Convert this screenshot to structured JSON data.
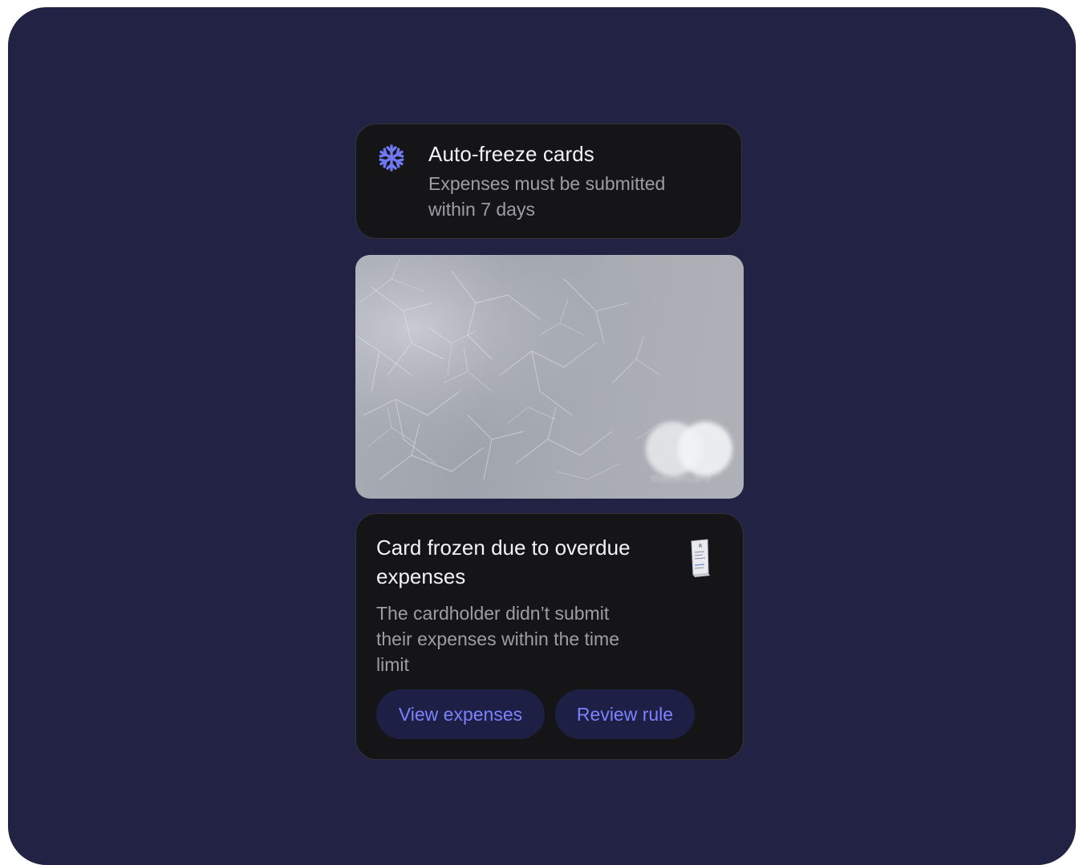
{
  "rule": {
    "icon": "snowflake-icon",
    "title": "Auto-freeze cards",
    "description": "Expenses must be submitted within 7 days"
  },
  "card": {
    "state": "frozen",
    "brand_word": "mastercard"
  },
  "notice": {
    "title": "Card frozen due to overdue expenses",
    "description": "The cardholder didn’t submit their expenses within the time limit",
    "icon": "receipt-icon",
    "buttons": {
      "view_expenses": "View expenses",
      "review_rule": "Review rule"
    }
  },
  "colors": {
    "background": "#222244",
    "card_surface": "#151518",
    "accent": "#7b82ff",
    "button_bg": "#1e1f45"
  }
}
